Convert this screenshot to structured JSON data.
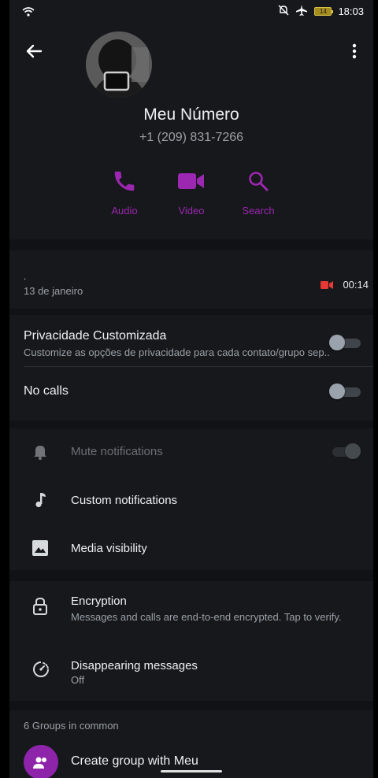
{
  "status_bar": {
    "time": "18:03",
    "battery": "14",
    "icons": [
      "wifi-icon",
      "dnd-off-icon",
      "airplane-icon",
      "battery-icon"
    ]
  },
  "header": {
    "back_icon": "arrow-left-icon",
    "menu_icon": "more-vertical-icon"
  },
  "profile": {
    "name": "Meu Número",
    "phone": "+1 (209) 831-7266"
  },
  "actions": [
    {
      "label": "Audio",
      "icon": "phone-icon"
    },
    {
      "label": "Video",
      "icon": "video-camera-icon"
    },
    {
      "label": "Search",
      "icon": "search-icon"
    }
  ],
  "accent_color": "#9c27b0",
  "call_log": {
    "marker": ".",
    "date": "13 de janeiro",
    "duration": "00:14",
    "icon": "missed-video-call-icon",
    "icon_color": "#e53935"
  },
  "settings": {
    "privacy_title": "Privacidade Customizada",
    "privacy_sub": "Customize as opções de privacidade para cada contato/grupo sep...",
    "privacy_enabled": false,
    "no_calls": "No calls",
    "no_calls_enabled": false,
    "mute": "Mute notifications",
    "mute_enabled": true,
    "custom_notifications": "Custom notifications",
    "media_visibility": "Media visibility",
    "encryption_title": "Encryption",
    "encryption_sub": "Messages and calls are end-to-end encrypted. Tap to verify.",
    "disappearing_title": "Disappearing messages",
    "disappearing_sub": "Off"
  },
  "groups": {
    "header": "6 Groups in common",
    "create_label": "Create group with Meu"
  }
}
